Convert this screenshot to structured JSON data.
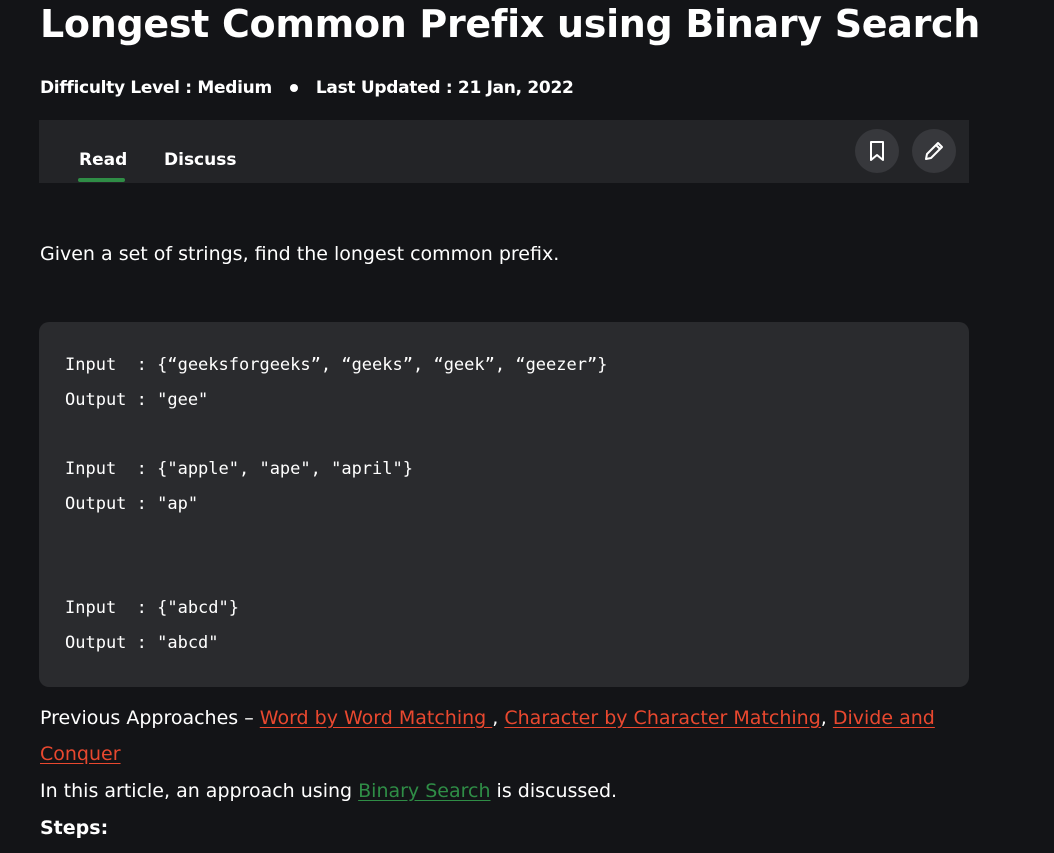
{
  "article": {
    "title": "Longest Common Prefix using Binary Search",
    "difficulty": "Difficulty Level : Medium",
    "last_updated": "Last Updated : 21 Jan, 2022"
  },
  "tabs": {
    "read": "Read",
    "discuss": "Discuss"
  },
  "intro": "Given a set of strings, find the longest common prefix.",
  "code": {
    "lines": [
      "Input  : {“geeksforgeeks”, “geeks”, “geek”, “geezer”}",
      "Output : \"gee\"",
      "Input  : {\"apple\", \"ape\", \"april\"}",
      "Output : \"ap\"",
      "Input  : {\"abcd\"}",
      "Output : \"abcd\""
    ]
  },
  "previous": {
    "prefix": "Previous Approaches – ",
    "link1": "Word by Word Matching ",
    "sep1": ", ",
    "link2": "Character by Character Matching",
    "sep2": ", ",
    "link3": "Divide and Conquer "
  },
  "approach": {
    "before": "In this article, an approach using ",
    "link": "Binary Search",
    "after": " is discussed."
  },
  "steps_label": "Steps:",
  "colors": {
    "background": "#131417",
    "tab_accent": "#2f8d46",
    "link_red": "#e9482f",
    "link_green": "#2f8d46"
  },
  "icons": [
    "bookmark-icon",
    "pencil-icon"
  ]
}
